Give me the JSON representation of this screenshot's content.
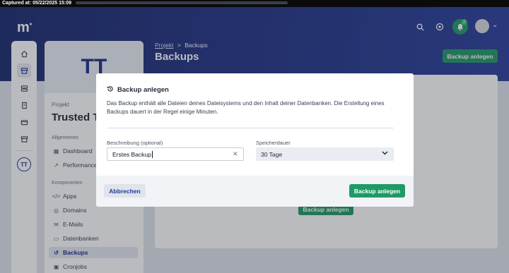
{
  "capture": {
    "label": "Captured at: 05/22/2025 15:09"
  },
  "header": {
    "logo": "m",
    "notification_count": "2"
  },
  "rail": {
    "avatar_initials": "TT"
  },
  "project": {
    "logo_initials": "TT",
    "label": "Projekt",
    "name": "Trusted T",
    "groups": [
      {
        "title": "Allgemeines",
        "items": [
          "Dashboard",
          "Performance"
        ]
      },
      {
        "title": "Komponenten",
        "items": [
          "Apps",
          "Domains",
          "E-Mails",
          "Datenbanken",
          "Backups",
          "Cronjobs"
        ]
      }
    ],
    "active_item": "Backups"
  },
  "page": {
    "breadcrumb_parent": "Projekt",
    "breadcrumb_sep": ">",
    "breadcrumb_current": "Backups",
    "title": "Backups",
    "primary_button": "Backup anlegen",
    "empty_state_button": "Backup anlegen"
  },
  "modal": {
    "title": "Backup anlegen",
    "description": "Das Backup enthält alle Dateien deines Dateisystems und den Inhalt deiner Datenbanken. Die Erstellung eines Backups dauert in der Regel einige Minuten.",
    "description_field": {
      "label": "Beschreibung (optional)",
      "value": "Erstes Backup"
    },
    "retention_field": {
      "label": "Speicherdauer",
      "value": "30 Tage"
    },
    "cancel_button": "Abbrechen",
    "submit_button": "Backup anlegen"
  },
  "colors": {
    "brand_blue": "#1c2f86",
    "accent_green": "#1f9a66"
  }
}
